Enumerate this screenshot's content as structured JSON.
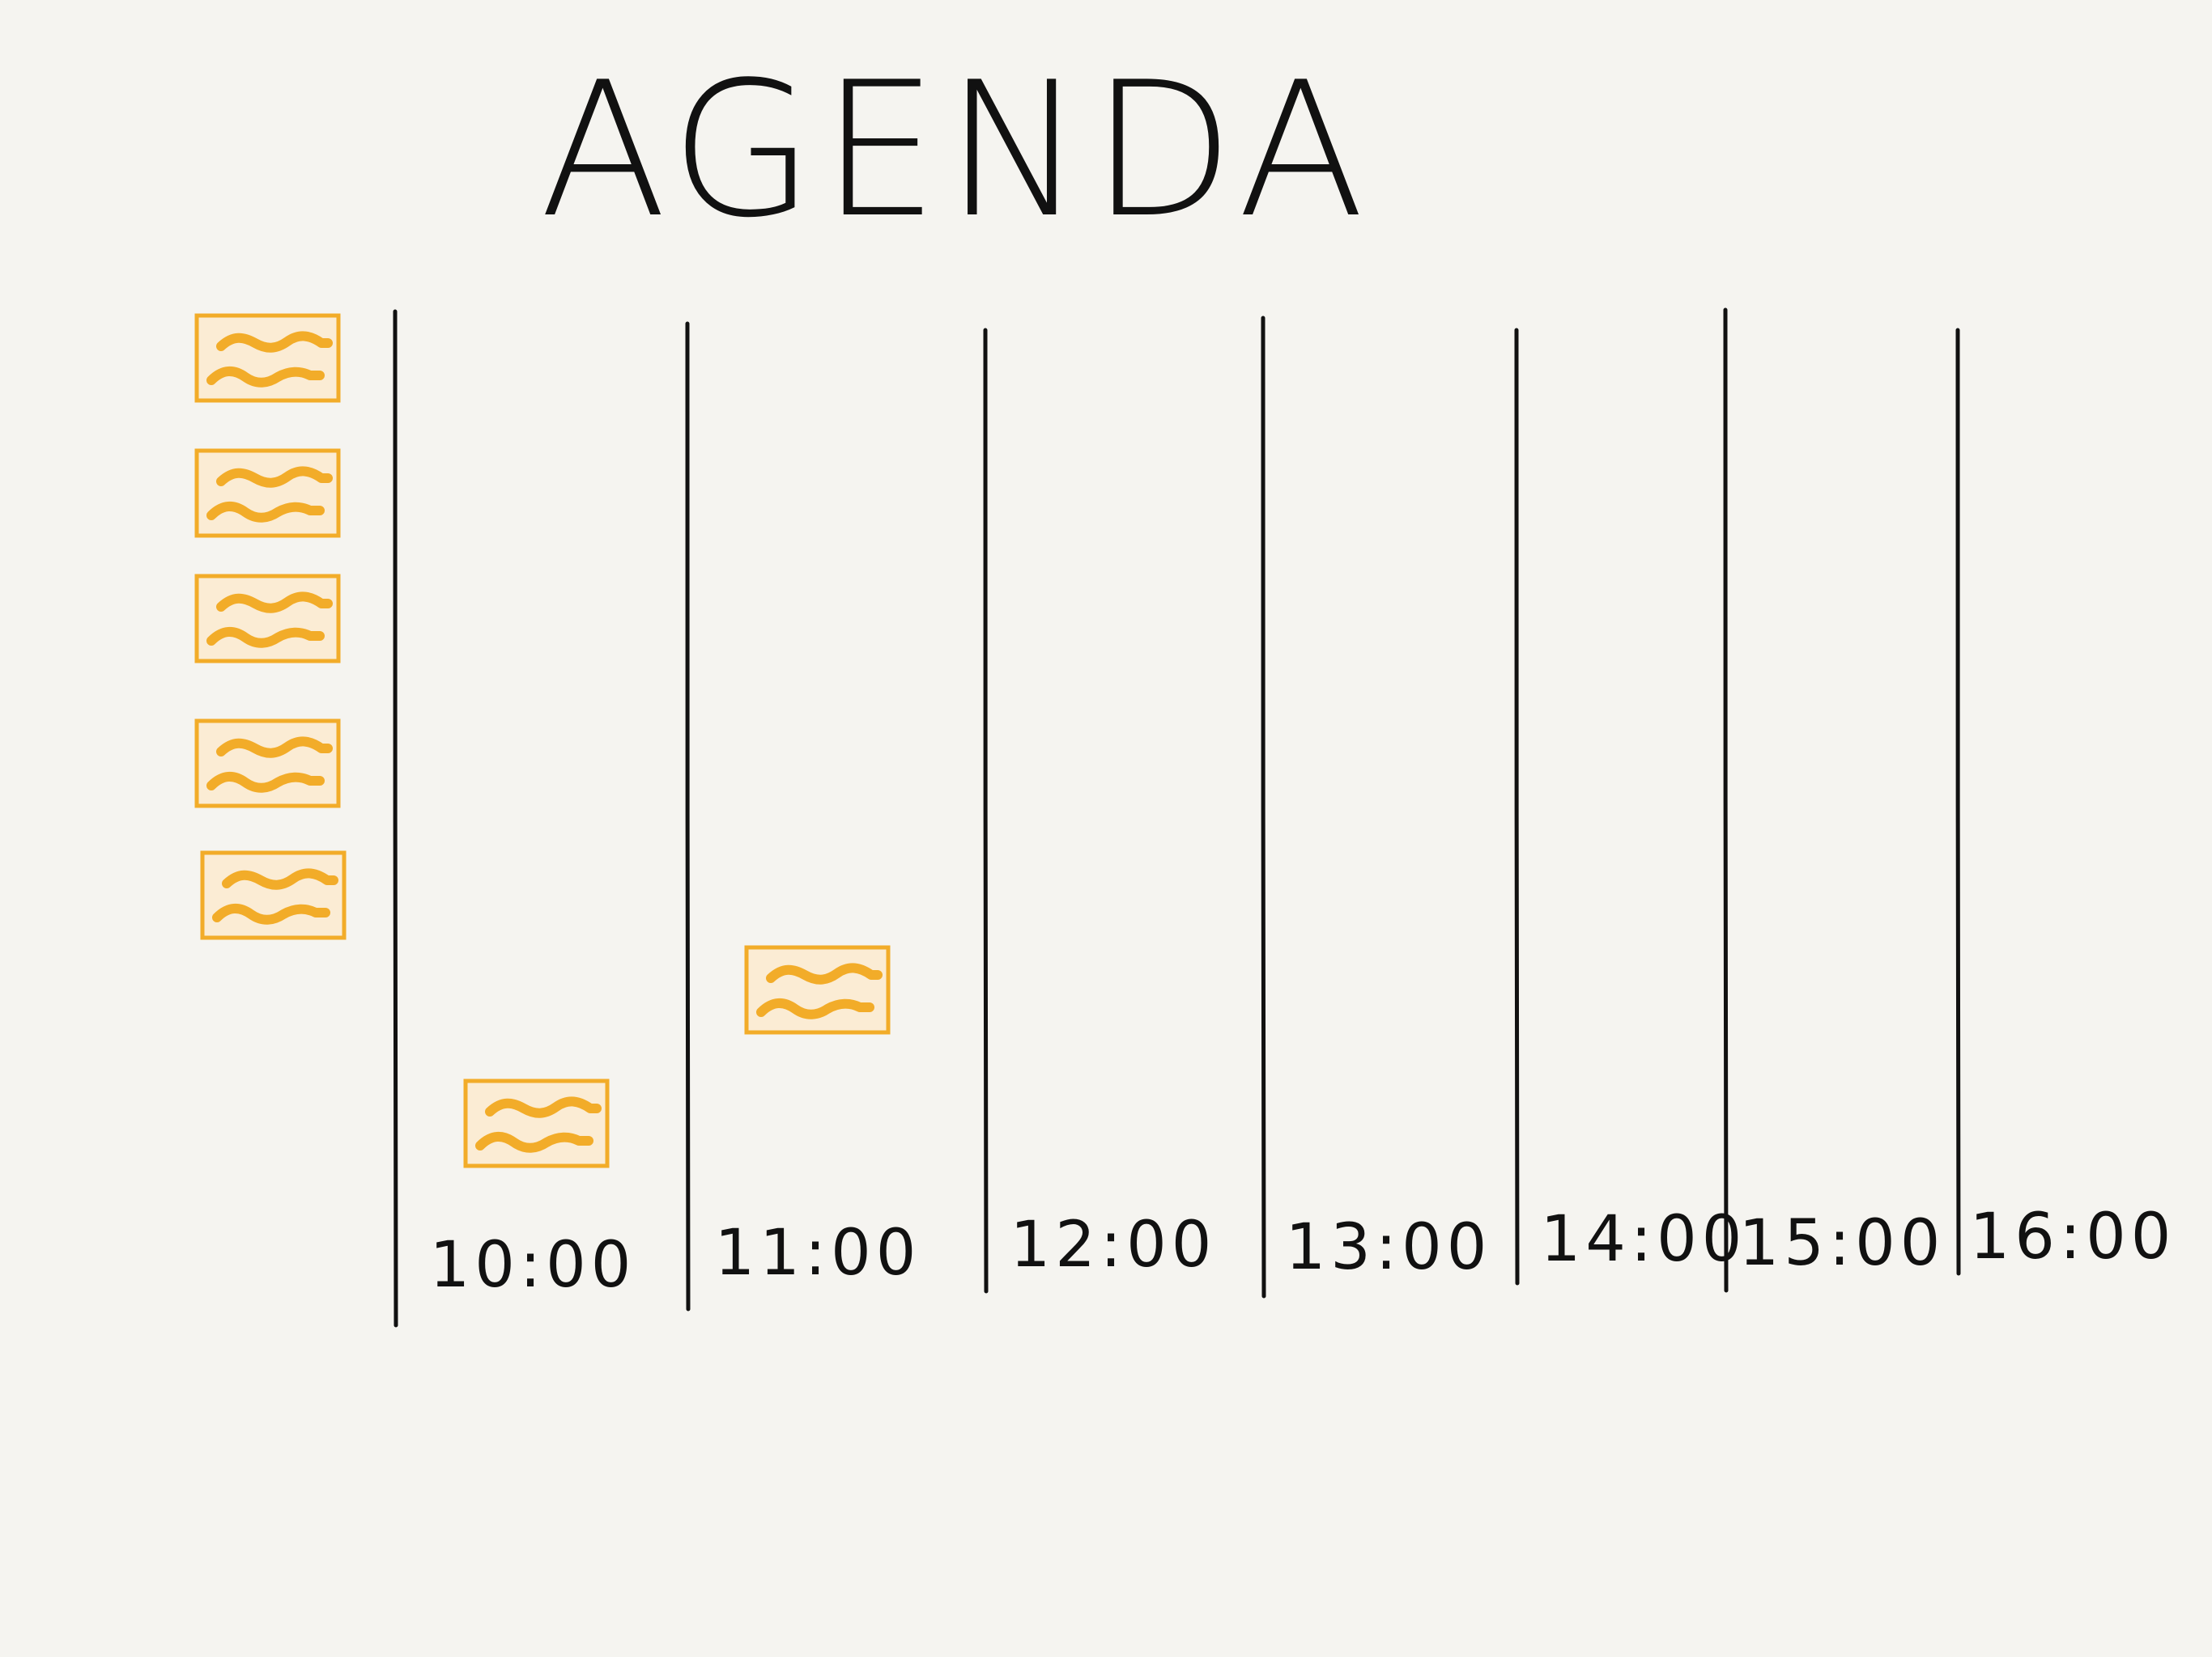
{
  "title": "AGENDA",
  "timeline": {
    "times": [
      "10:00",
      "11:00",
      "12:00",
      "13:00",
      "14:00",
      "15:00",
      "16:00"
    ]
  },
  "cards": {
    "backlog_count": 5,
    "scheduled": [
      {
        "time": "10:00"
      },
      {
        "time": "11:00"
      }
    ]
  },
  "colors": {
    "background": "#f5f4f0",
    "ink": "#111111",
    "card_fill": "#fbecd4",
    "card_stroke": "#f2ac29"
  },
  "icons": {
    "card_content": "squiggle-placeholder-icon"
  }
}
